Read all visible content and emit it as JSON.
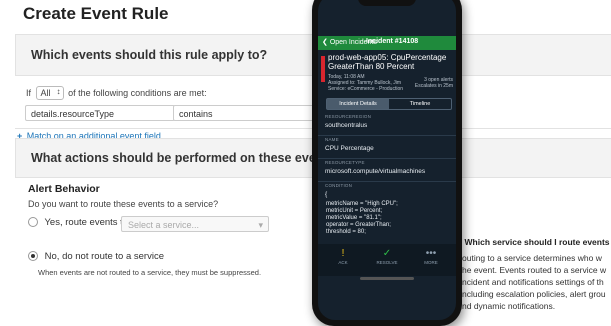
{
  "page_title": "Create Event Rule",
  "section1": {
    "heading": "Which events should this rule apply to?",
    "cond_prefix": "If",
    "cond_select": "All",
    "cond_suffix": "of the following conditions are met:",
    "field_value": "details.resourceType",
    "operator_value": "contains",
    "match_link": "Match on an additional event field"
  },
  "section2": {
    "heading": "What actions should be performed on these events?",
    "alert_title": "Alert Behavior",
    "question": "Do you want to route these events to a service?",
    "yes_label": "Yes, route events to",
    "service_placeholder": "Select a service...",
    "no_label": "No, do not route to a service",
    "no_hint": "When events are not routed to a service, they must be suppressed."
  },
  "help": {
    "title": "Which service should I route events",
    "lines": [
      "outing to a service determines who w",
      "he event. Events routed to a service w",
      "ncident and notifications settings of th",
      "ncluding escalation policies, alert grou",
      "nd dynamic notifications."
    ]
  },
  "phone": {
    "back_label": "Open Incidents",
    "incident_title": "Incident #14108",
    "incident_name": "prod-web-app05: CpuPercentage GreaterThan 80 Percent",
    "meta_lines": [
      "Today, 11:08 AM",
      "Assigned to: Tammy Bullock, Jim",
      "Service: eCommerce - Production"
    ],
    "right_lines": [
      "3 open alerts",
      "Escalates in 25m"
    ],
    "tab_details": "Incident Details",
    "tab_timeline": "Timeline",
    "fields": [
      {
        "key": "RESOURCEREGION",
        "value": "southcentralus"
      },
      {
        "key": "NAME",
        "value": "CPU Percentage"
      },
      {
        "key": "RESOURCETYPE",
        "value": "microsoft.compute/virtualmachines"
      },
      {
        "key": "CONDITION",
        "value": "{"
      }
    ],
    "code": "metricName = \"High CPU\";\nmetricUnit = Percent;\nmetricValue = \"81.1\";\noperator = GreaterThan;\nthreshold = 80;",
    "bottom": [
      {
        "icon": "!",
        "label": "ACK"
      },
      {
        "icon": "✓",
        "label": "RESOLVE"
      },
      {
        "icon": "•••",
        "label": "MORE"
      }
    ],
    "colors": {
      "green": "#1f8a3c",
      "red": "#d9262e",
      "screen_bg": "#15212d"
    }
  }
}
